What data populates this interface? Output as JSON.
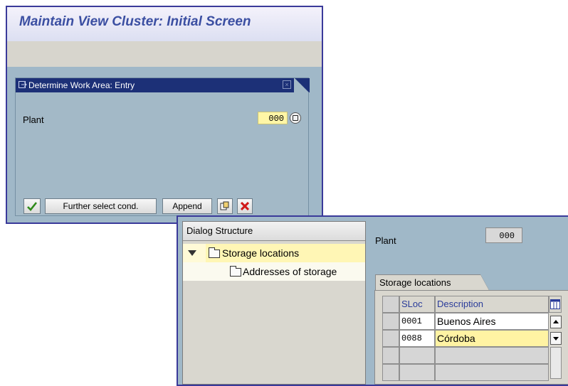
{
  "window1": {
    "title": "Maintain View Cluster: Initial Screen",
    "dialog": {
      "title": "Determine Work Area: Entry",
      "plant_label": "Plant",
      "plant_value": "000",
      "buttons": {
        "further_select": "Further select cond.",
        "append": "Append"
      }
    }
  },
  "window2": {
    "dialog_structure": {
      "header": "Dialog Structure",
      "items": [
        {
          "label": "Storage locations",
          "icon": "folder-open-icon"
        },
        {
          "label": "Addresses of storage",
          "icon": "folder-icon"
        }
      ]
    },
    "plant_label": "Plant",
    "plant_value": "000",
    "tab_label": "Storage locations",
    "table": {
      "columns": [
        "SLoc",
        "Description"
      ],
      "rows": [
        {
          "sloc": "0001",
          "description": "Buenos Aires"
        },
        {
          "sloc": "0088",
          "description": "Córdoba"
        }
      ]
    }
  },
  "colors": {
    "title_text": "#3b4fa2",
    "dialog_title_bar": "#1c3077",
    "input_yellow": "#fff6a6",
    "panel_blue": "#a0b8c8"
  }
}
